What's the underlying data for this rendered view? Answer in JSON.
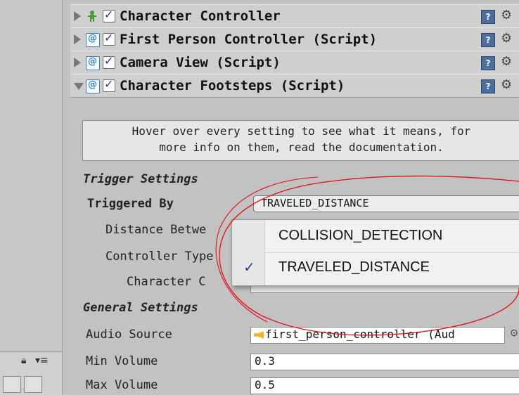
{
  "components": [
    {
      "title": "Character Controller",
      "icon": "character-controller-icon",
      "expanded": false
    },
    {
      "title": "First Person Controller (Script)",
      "icon": "script-icon",
      "expanded": false
    },
    {
      "title": "Camera View (Script)",
      "icon": "script-icon",
      "expanded": false
    },
    {
      "title": "Character Footsteps (Script)",
      "icon": "script-icon",
      "expanded": true
    }
  ],
  "script_icon_glyph": "@",
  "help_icon_glyph": "?",
  "gear_icon_glyph": "⚙",
  "help_box": {
    "line1": "Hover over every setting to see what it means, for",
    "line2": "more info on them, read the documentation."
  },
  "trigger_settings": {
    "header": "Trigger Settings",
    "triggered_by_label": "Triggered By",
    "triggered_by_value": "TRAVELED_DISTANCE",
    "distance_label": "Distance Betwe",
    "controller_type_label": "Controller Type",
    "character_label": "Character C"
  },
  "dropdown_options": [
    {
      "label": "COLLISION_DETECTION",
      "selected": false
    },
    {
      "label": "TRAVELED_DISTANCE",
      "selected": true
    }
  ],
  "general_settings": {
    "header": "General Settings",
    "audio_source_label": "Audio Source",
    "audio_source_value": "first_person_controller (Aud",
    "min_volume_label": "Min Volume",
    "min_volume_value": "0.3",
    "max_volume_label": "Max Volume",
    "max_volume_value": "0.5"
  },
  "colors": {
    "annotation": "#e01010",
    "help_icon": "#4a6f9a",
    "checkmark": "#1c3f95"
  }
}
